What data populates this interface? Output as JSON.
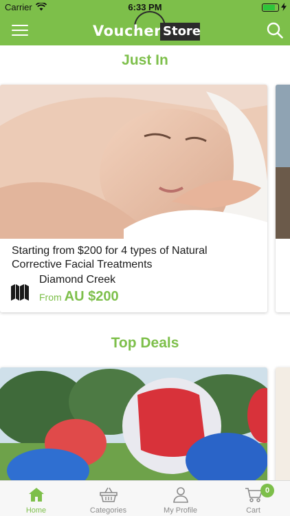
{
  "status_bar": {
    "carrier": "Carrier",
    "time": "6:33 PM",
    "battery_level": 0.85
  },
  "navbar": {
    "logo_word1": "Voucher",
    "logo_word2": "Store",
    "menu_icon": "hamburger-menu-icon",
    "search_icon": "search-icon"
  },
  "sections": {
    "just_in": {
      "title": "Just In",
      "deal": {
        "title": "Starting from $200 for 4 types of Natural Corrective Facial Treatments",
        "merchant": "Diamond Creek",
        "price_prefix": "From",
        "price": "AU $200"
      }
    },
    "top_deals": {
      "title": "Top Deals"
    }
  },
  "tabbar": {
    "tabs": [
      {
        "label": "Home",
        "icon": "home-icon",
        "active": true
      },
      {
        "label": "Categories",
        "icon": "basket-icon",
        "active": false
      },
      {
        "label": "My Profile",
        "icon": "person-icon",
        "active": false
      },
      {
        "label": "Cart",
        "icon": "cart-icon",
        "active": false
      }
    ],
    "cart_count": "0"
  },
  "colors": {
    "brand_green": "#7dbf4a",
    "text_dark": "#1a1a1a",
    "tab_inactive": "#8a8a8a"
  }
}
